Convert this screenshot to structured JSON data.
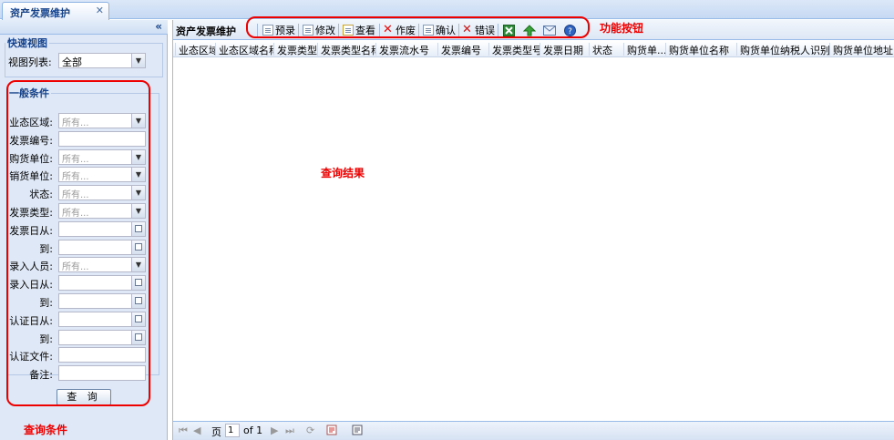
{
  "tab": {
    "title": "资产发票维护",
    "close": "✕"
  },
  "left": {
    "collapse": "«",
    "quick_view": {
      "legend": "快速视图",
      "label": "视图列表:",
      "value": "全部"
    },
    "general": {
      "legend": "一般条件",
      "fields": [
        {
          "label": "业态区域:",
          "type": "select",
          "placeholder": "所有..."
        },
        {
          "label": "发票编号:",
          "type": "text",
          "placeholder": ""
        },
        {
          "label": "购货单位:",
          "type": "select",
          "placeholder": "所有..."
        },
        {
          "label": "销货单位:",
          "type": "select",
          "placeholder": "所有..."
        },
        {
          "label": "状态:",
          "type": "select",
          "placeholder": "所有..."
        },
        {
          "label": "发票类型:",
          "type": "select",
          "placeholder": "所有..."
        },
        {
          "label": "发票日从:",
          "type": "date",
          "placeholder": ""
        },
        {
          "label": "到:",
          "type": "date",
          "placeholder": ""
        },
        {
          "label": "录入人员:",
          "type": "select",
          "placeholder": "所有..."
        },
        {
          "label": "录入日从:",
          "type": "date",
          "placeholder": ""
        },
        {
          "label": "到:",
          "type": "date",
          "placeholder": ""
        },
        {
          "label": "认证日从:",
          "type": "date",
          "placeholder": ""
        },
        {
          "label": "到:",
          "type": "date",
          "placeholder": ""
        },
        {
          "label": "认证文件:",
          "type": "text",
          "placeholder": ""
        },
        {
          "label": "备注:",
          "type": "text",
          "placeholder": ""
        }
      ]
    },
    "query_button": "查 询"
  },
  "main": {
    "title": "资产发票维护",
    "toolbar": {
      "enter": "预录",
      "edit": "修改",
      "view": "查看",
      "void": "作废",
      "confirm": "确认",
      "error": "错误"
    },
    "columns": [
      "业态区域",
      "业态区域名称",
      "发票类型",
      "发票类型名称",
      "发票流水号",
      "发票编号",
      "发票类型号",
      "发票日期",
      "状态",
      "购货单...",
      "购货单位名称",
      "购货单位纳税人识别号",
      "购货单位地址电"
    ],
    "pager": {
      "page_label": "页",
      "page_value": "1",
      "of_label": "of 1"
    }
  },
  "annotations": {
    "toolbar": "功能按钮",
    "results": "查询结果",
    "conditions": "查询条件"
  },
  "colors": {
    "annotation": "#e00000",
    "panel_bg": "#dfe8f6",
    "header_text": "#15428b"
  }
}
